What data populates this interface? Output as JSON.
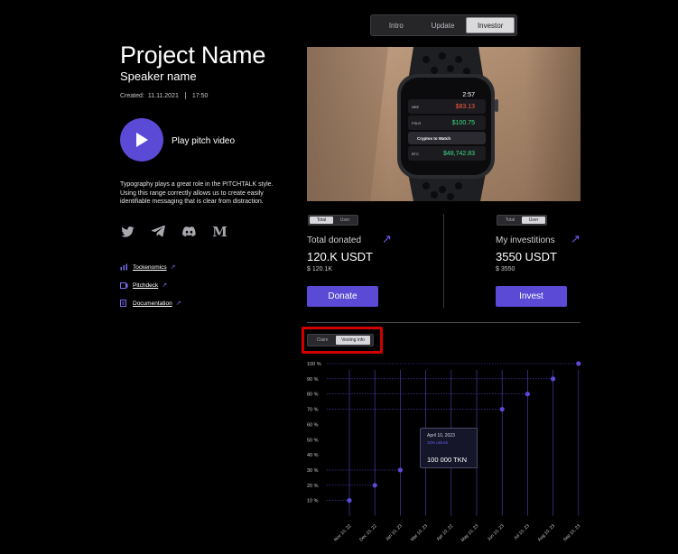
{
  "tabs": [
    {
      "label": "Intro",
      "active": false
    },
    {
      "label": "Update",
      "active": false
    },
    {
      "label": "Investor",
      "active": true
    }
  ],
  "project": {
    "title": "Project Name",
    "speaker": "Speaker name",
    "created_label": "Created:",
    "created_date": "11.11.2021",
    "created_time": "17:50",
    "play_label": "Play pitch video",
    "description": "Typography plays a great role in the PITCHTALK style. Using this range correctly allows us to create easily identifiable messaging that is clear from distraction."
  },
  "socials": [
    "twitter-icon",
    "telegram-icon",
    "discord-icon",
    "medium-icon"
  ],
  "medium_glyph": "M",
  "links": [
    {
      "label": "Tockenomics",
      "icon": "chart-icon"
    },
    {
      "label": "Pitchdeck",
      "icon": "video-icon"
    },
    {
      "label": "Documentation",
      "icon": "document-icon"
    }
  ],
  "watch": {
    "time": "2:57",
    "rows": [
      {
        "ticker": "NEE",
        "value": "$83.13",
        "color": "#ff5a3c"
      },
      {
        "ticker": "FSLR",
        "value": "$100.75",
        "color": "#3ddc84"
      },
      {
        "ticker": "",
        "value": "Cryptos to Watch",
        "color": "#ffffff"
      },
      {
        "ticker": "BTC",
        "value": "$48,742.83",
        "color": "#3ddc84"
      }
    ]
  },
  "donated": {
    "toggle": [
      "Total",
      "User"
    ],
    "active": 0,
    "label": "Total donated",
    "value": "120.K USDT",
    "sub": "$ 120.1K",
    "button": "Donate"
  },
  "invested": {
    "toggle": [
      "Total",
      "User"
    ],
    "active": 1,
    "label": "My investitions",
    "value": "3550 USDT",
    "sub": "$ 3550",
    "button": "Invest"
  },
  "chart_toggle": [
    "Claim",
    "Vesting info"
  ],
  "tooltip": {
    "date": "April 10, 2023",
    "unlock": "10% unlock",
    "value": "100 000 TKN"
  },
  "colors": {
    "accent": "#5b4ad6",
    "highlight": "#d10000"
  },
  "chart_data": {
    "type": "scatter",
    "categories": [
      "Nov 10, 22",
      "Dec 10, 22",
      "Jan 10, 23",
      "Mar 10, 23",
      "Apr 10, 22",
      "May 10, 23",
      "Jun 10, 23",
      "Jul 10, 23",
      "Aug 10, 23",
      "Sep 10, 23"
    ],
    "y_ticks": [
      "10 %",
      "20 %",
      "30 %",
      "40 %",
      "50 %",
      "60 %",
      "70 %",
      "80 %",
      "90 %",
      "100 %"
    ],
    "y_values": [
      10,
      20,
      30,
      40,
      50,
      60,
      70,
      80,
      90,
      100
    ],
    "points": [
      {
        "category": "Nov 10, 22",
        "y": 10
      },
      {
        "category": "Dec 10, 22",
        "y": 20
      },
      {
        "category": "Jan 10, 23",
        "y": 30
      },
      {
        "category": "Jun 10, 23",
        "y": 70
      },
      {
        "category": "Jul 10, 23",
        "y": 80
      },
      {
        "category": "Aug 10, 23",
        "y": 90
      },
      {
        "category": "Sep 10, 23",
        "y": 100
      }
    ],
    "ylim": [
      0,
      100
    ]
  }
}
